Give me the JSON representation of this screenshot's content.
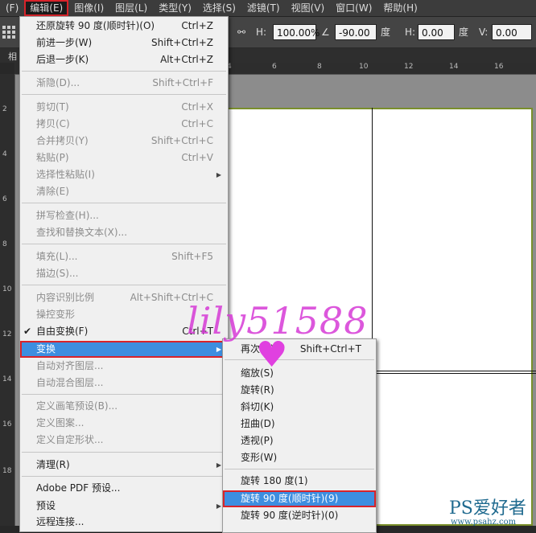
{
  "menubar": {
    "items": [
      "(F)",
      "编辑(E)",
      "图像(I)",
      "图层(L)",
      "类型(Y)",
      "选择(S)",
      "滤镜(T)",
      "视图(V)",
      "窗口(W)",
      "帮助(H)"
    ],
    "active_index": 1
  },
  "options_bar": {
    "h_label": "H:",
    "h_value": "100.00%",
    "angle_value": "-90.00",
    "angle_unit": "度",
    "skew_h_label": "H:",
    "skew_h_value": "0.00",
    "skew_h_unit": "度",
    "skew_v_label": "V:",
    "skew_v_value": "0.00"
  },
  "tab_label": "相",
  "ruler": {
    "horizontal": [
      "4",
      "6",
      "8",
      "10",
      "12",
      "14",
      "16"
    ],
    "vertical": [
      "2",
      "4",
      "6",
      "8",
      "10",
      "12",
      "14",
      "16",
      "18"
    ]
  },
  "edit_menu": {
    "items": [
      {
        "label": "还原旋转 90 度(顺时针)(O)",
        "shortcut": "Ctrl+Z"
      },
      {
        "label": "前进一步(W)",
        "shortcut": "Shift+Ctrl+Z"
      },
      {
        "label": "后退一步(K)",
        "shortcut": "Alt+Ctrl+Z"
      },
      {
        "label": "渐隐(D)...",
        "shortcut": "Shift+Ctrl+F"
      },
      {
        "label": "剪切(T)",
        "shortcut": "Ctrl+X"
      },
      {
        "label": "拷贝(C)",
        "shortcut": "Ctrl+C"
      },
      {
        "label": "合并拷贝(Y)",
        "shortcut": "Shift+Ctrl+C"
      },
      {
        "label": "粘贴(P)",
        "shortcut": "Ctrl+V"
      },
      {
        "label": "选择性粘贴(I)",
        "shortcut": ""
      },
      {
        "label": "清除(E)",
        "shortcut": ""
      },
      {
        "label": "拼写检查(H)...",
        "shortcut": ""
      },
      {
        "label": "查找和替换文本(X)...",
        "shortcut": ""
      },
      {
        "label": "填充(L)...",
        "shortcut": "Shift+F5"
      },
      {
        "label": "描边(S)...",
        "shortcut": ""
      },
      {
        "label": "内容识别比例",
        "shortcut": "Alt+Shift+Ctrl+C"
      },
      {
        "label": "操控变形",
        "shortcut": ""
      },
      {
        "label": "自由变换(F)",
        "shortcut": "Ctrl+T"
      },
      {
        "label": "变换",
        "shortcut": ""
      },
      {
        "label": "自动对齐图层...",
        "shortcut": ""
      },
      {
        "label": "自动混合图层...",
        "shortcut": ""
      },
      {
        "label": "定义画笔预设(B)...",
        "shortcut": ""
      },
      {
        "label": "定义图案...",
        "shortcut": ""
      },
      {
        "label": "定义自定形状...",
        "shortcut": ""
      },
      {
        "label": "清理(R)",
        "shortcut": ""
      },
      {
        "label": "Adobe PDF 预设...",
        "shortcut": ""
      },
      {
        "label": "预设",
        "shortcut": ""
      },
      {
        "label": "远程连接...",
        "shortcut": ""
      }
    ]
  },
  "transform_submenu": {
    "items": [
      {
        "label": "再次(A)",
        "shortcut": "Shift+Ctrl+T"
      },
      {
        "label": "缩放(S)",
        "shortcut": ""
      },
      {
        "label": "旋转(R)",
        "shortcut": ""
      },
      {
        "label": "斜切(K)",
        "shortcut": ""
      },
      {
        "label": "扭曲(D)",
        "shortcut": ""
      },
      {
        "label": "透视(P)",
        "shortcut": ""
      },
      {
        "label": "变形(W)",
        "shortcut": ""
      },
      {
        "label": "旋转 180 度(1)",
        "shortcut": ""
      },
      {
        "label": "旋转 90 度(顺时针)(9)",
        "shortcut": ""
      },
      {
        "label": "旋转 90 度(逆时针)(0)",
        "shortcut": ""
      }
    ]
  },
  "watermarks": {
    "user": "lily51588",
    "heart": "♥",
    "site_logo": "PS爱好者",
    "site_url": "www.psahz.com"
  },
  "colors": {
    "highlight": "#3d8ee0",
    "callout_red": "#d8232a",
    "doc_border": "#7a8f2b"
  }
}
